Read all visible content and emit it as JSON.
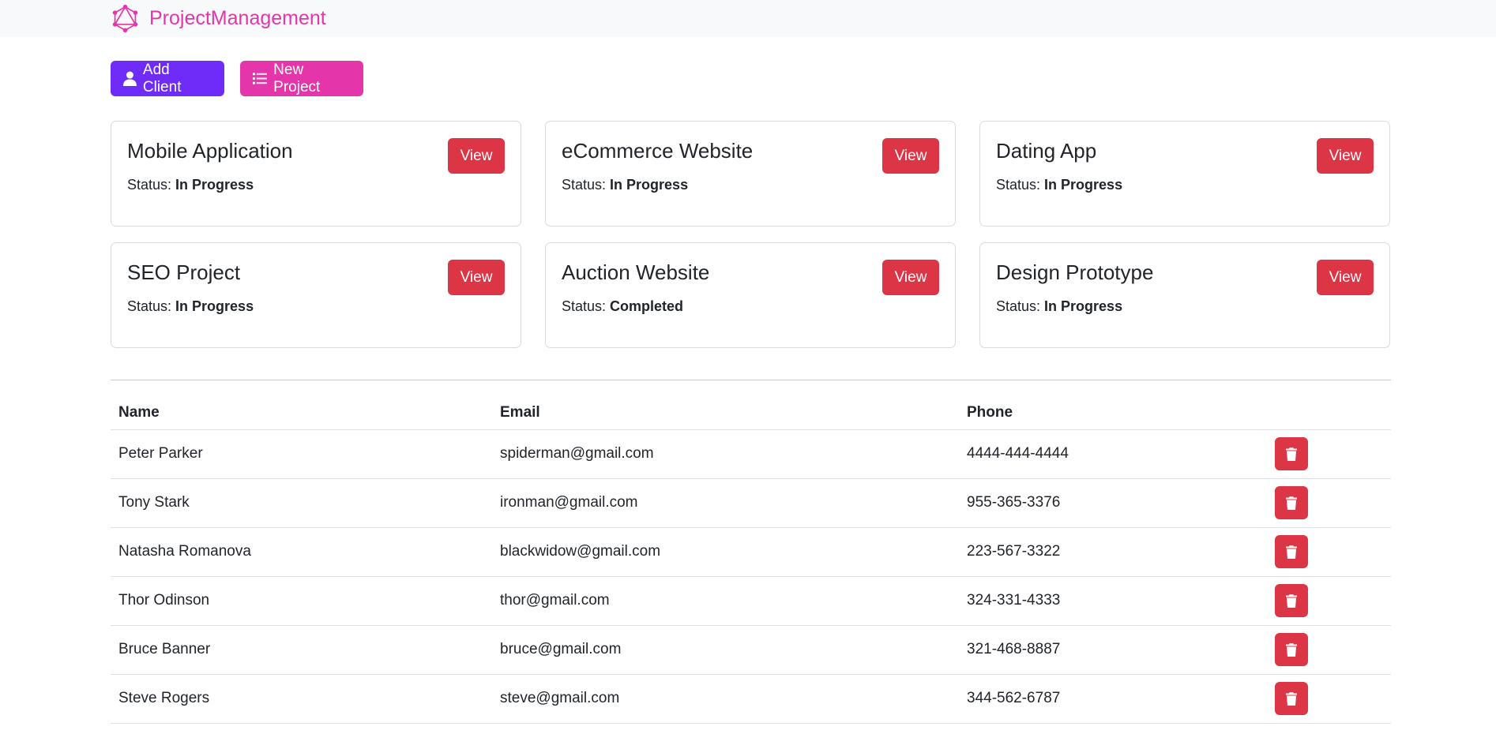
{
  "nav": {
    "brand": "ProjectManagement"
  },
  "actions": {
    "add_client": "Add Client",
    "new_project": "New Project"
  },
  "status_label": "Status:",
  "view_label": "View",
  "projects": [
    {
      "name": "Mobile Application",
      "status": "In Progress"
    },
    {
      "name": "eCommerce Website",
      "status": "In Progress"
    },
    {
      "name": "Dating App",
      "status": "In Progress"
    },
    {
      "name": "SEO Project",
      "status": "In Progress"
    },
    {
      "name": "Auction Website",
      "status": "Completed"
    },
    {
      "name": "Design Prototype",
      "status": "In Progress"
    }
  ],
  "table": {
    "headers": {
      "name": "Name",
      "email": "Email",
      "phone": "Phone"
    },
    "rows": [
      {
        "name": "Peter Parker",
        "email": "spiderman@gmail.com",
        "phone": "4444-444-4444"
      },
      {
        "name": "Tony Stark",
        "email": "ironman@gmail.com",
        "phone": "955-365-3376"
      },
      {
        "name": "Natasha Romanova",
        "email": "blackwidow@gmail.com",
        "phone": "223-567-3322"
      },
      {
        "name": "Thor Odinson",
        "email": "thor@gmail.com",
        "phone": "324-331-4333"
      },
      {
        "name": "Bruce Banner",
        "email": "bruce@gmail.com",
        "phone": "321-468-8887"
      },
      {
        "name": "Steve Rogers",
        "email": "steve@gmail.com",
        "phone": "344-562-6787"
      }
    ]
  },
  "colors": {
    "brand": "#e535ab",
    "client_button": "#6f2bf7",
    "danger": "#dc3545"
  },
  "icons": {
    "logo": "graphql-logo-icon",
    "add_client": "user-icon",
    "new_project": "list-icon",
    "delete": "trash-icon"
  }
}
